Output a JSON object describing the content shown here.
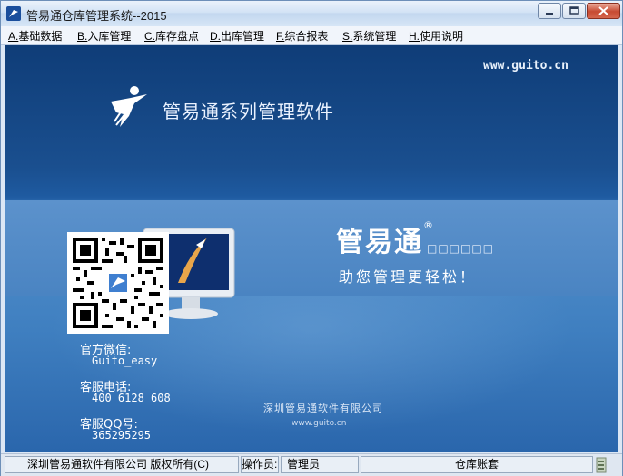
{
  "window": {
    "title": "管易通仓库管理系统--2015",
    "controls": [
      "minimize",
      "maximize",
      "close"
    ]
  },
  "menu": [
    {
      "key": "A.",
      "label": "基础数据"
    },
    {
      "key": "B.",
      "label": "入库管理"
    },
    {
      "key": "C.",
      "label": "库存盘点"
    },
    {
      "key": "D.",
      "label": "出库管理"
    },
    {
      "key": "F.",
      "label": "综合报表"
    },
    {
      "key": "S.",
      "label": "系统管理"
    },
    {
      "key": "H.",
      "label": "使用说明"
    }
  ],
  "splash": {
    "website": "www.guito.cn",
    "series_title": "管易通系列管理软件",
    "brand": "管易通",
    "registered_mark": "®",
    "brand_suffix": "□□□□□□",
    "slogan": "助您管理更轻松！",
    "wechat_label": "官方微信:",
    "wechat_value": "Guito_easy",
    "phone_label": "客服电话:",
    "phone_value": "400 6128 608",
    "qq_label": "客服QQ号:",
    "qq_value": "365295295",
    "company_small": "深圳管易通软件有限公司",
    "url_small": "www.guito.cn"
  },
  "status": {
    "copyright": "深圳管易通软件有限公司 版权所有(C)",
    "operator_label": "操作员:",
    "operator_value": "管理员",
    "account_set": "仓库账套"
  },
  "colors": {
    "titlebar": "#d3e3f5",
    "content_top": "#0f3d78",
    "content_band": "#5c92cc",
    "close_button": "#c74a32"
  },
  "icons": [
    "app-logo-icon",
    "minimize-icon",
    "maximize-icon",
    "close-icon",
    "brand-figure-icon",
    "monitor-illustration",
    "qr-code",
    "resize-grip-icon"
  ]
}
